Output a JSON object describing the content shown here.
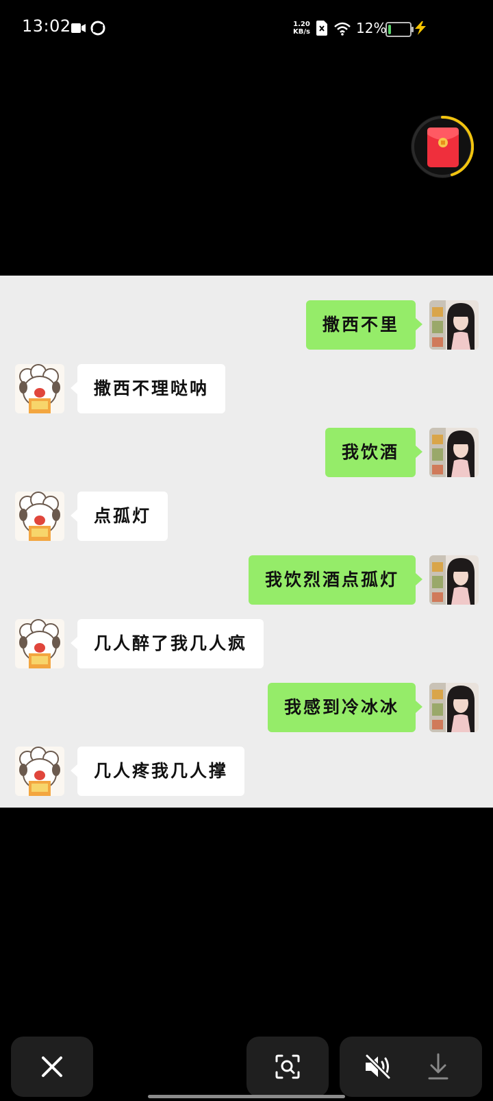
{
  "status_bar": {
    "time": "13:02",
    "net_speed_value": "1.20",
    "net_speed_unit": "KB/s",
    "battery_percent": "12%",
    "battery_level": 0.12,
    "icons": [
      "video-record-icon",
      "app-swirl-icon",
      "sim-x-icon",
      "wifi-icon",
      "battery-icon",
      "charging-bolt-icon"
    ]
  },
  "floating": {
    "icon": "red-envelope-icon",
    "progress_ring_color": "#f2c40f"
  },
  "chat": {
    "background": "#ededed",
    "sent_bubble_color": "#95ec69",
    "received_bubble_color": "#ffffff",
    "messages": [
      {
        "side": "right",
        "text": "撒西不里"
      },
      {
        "side": "left",
        "text": "撒西不理哒呐"
      },
      {
        "side": "right",
        "text": "我饮酒"
      },
      {
        "side": "left",
        "text": "点孤灯"
      },
      {
        "side": "right",
        "text": "我饮烈酒点孤灯"
      },
      {
        "side": "left",
        "text": "几人醉了我几人疯"
      },
      {
        "side": "right",
        "text": "我感到冷冰冰"
      },
      {
        "side": "left",
        "text": "几人疼我几人撑"
      }
    ]
  },
  "toolbar": {
    "buttons": [
      "close-icon",
      "scan-search-icon",
      "mute-icon",
      "download-icon"
    ]
  }
}
